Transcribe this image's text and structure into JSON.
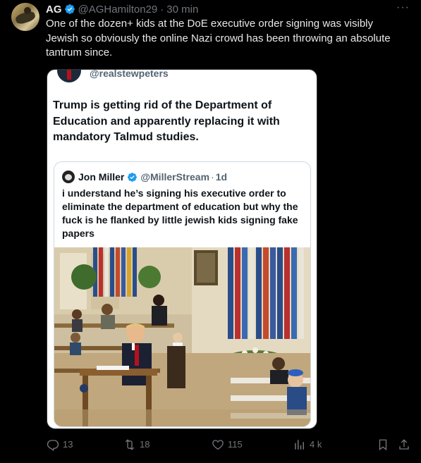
{
  "tweet": {
    "author_name": "AG",
    "handle": "@AGHamilton29",
    "separator": "·",
    "time": "30 min",
    "text": "One of the dozen+ kids at the DoE executive order signing was visibly Jewish so obviously the online Nazi crowd has been throwing an absolute tantrum since.",
    "more_icon": "more-horizontal-icon"
  },
  "embedded_post": {
    "handle": "@realstewpeters",
    "text": "Trump is getting rid of the Department of Education and apparently replacing it with mandatory Talmud studies.",
    "quote": {
      "author_name": "Jon Miller",
      "handle": "@MillerStream",
      "separator": "·",
      "time": "1d",
      "text": "i understand he’s signing his executive order to eliminate the department of education but why the fuck is he flanked by little jewish kids signing fake papers"
    }
  },
  "actions": {
    "replies": "13",
    "reposts": "18",
    "likes": "115",
    "views": "4 k"
  },
  "colors": {
    "background": "#000000",
    "text": "#e7e9ea",
    "secondary": "#71767b",
    "verified": "#1d9bf0"
  }
}
